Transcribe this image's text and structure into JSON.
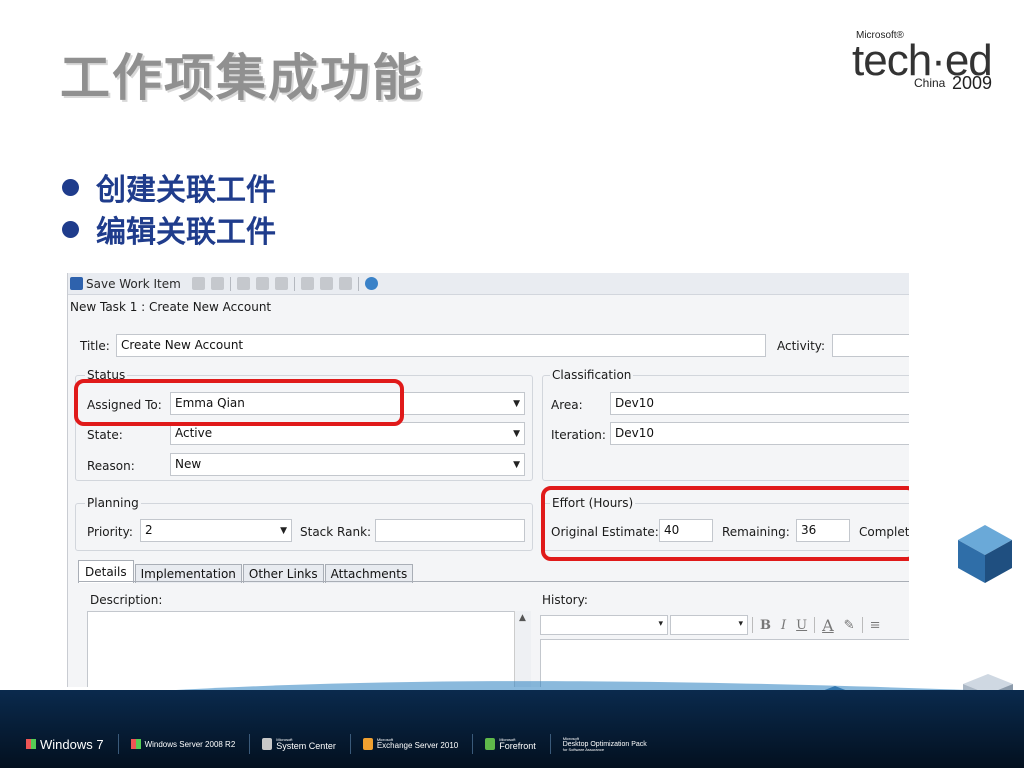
{
  "slide": {
    "title": "工作项集成功能",
    "bullets": [
      "创建关联工件",
      "编辑关联工件"
    ]
  },
  "logo": {
    "maker": "Microsoft®",
    "brand": "tech·ed",
    "region": "China",
    "year": "2009"
  },
  "toolbar": {
    "save_label": "Save Work Item",
    "icons": [
      "save-icon",
      "refresh-icon",
      "undo-icon",
      "copy-icon",
      "paste-icon",
      "attach-icon",
      "link-icon",
      "print-icon",
      "mail-icon",
      "help-icon"
    ]
  },
  "form": {
    "title": "New Task 1 : Create New Account",
    "title_label": "Title:",
    "title_value": "Create New Account",
    "activity_label": "Activity:",
    "activity_value": "",
    "status": {
      "header": "Status",
      "assigned_label": "Assigned To:",
      "assigned_value": "Emma Qian",
      "state_label": "State:",
      "state_value": "Active",
      "reason_label": "Reason:",
      "reason_value": "New"
    },
    "classification": {
      "header": "Classification",
      "area_label": "Area:",
      "area_value": "Dev10",
      "iteration_label": "Iteration:",
      "iteration_value": "Dev10"
    },
    "planning": {
      "header": "Planning",
      "priority_label": "Priority:",
      "priority_value": "2",
      "stack_rank_label": "Stack Rank:",
      "stack_rank_value": ""
    },
    "effort": {
      "header": "Effort (Hours)",
      "original_label": "Original Estimate:",
      "original_value": "40",
      "remaining_label": "Remaining:",
      "remaining_value": "36",
      "completed_label": "Complet"
    },
    "tabs": [
      "Details",
      "Implementation",
      "Other Links",
      "Attachments"
    ],
    "description_label": "Description:",
    "history_label": "History:",
    "rte_buttons": [
      "B",
      "I",
      "U",
      "A"
    ]
  },
  "footer": {
    "products": [
      {
        "name": "Windows 7",
        "pre": ""
      },
      {
        "name": "Windows Server 2008 R2",
        "pre": ""
      },
      {
        "name": "System Center",
        "pre": "Microsoft"
      },
      {
        "name": "Exchange Server 2010",
        "pre": "Microsoft"
      },
      {
        "name": "Forefront",
        "pre": "Microsoft"
      },
      {
        "name": "Desktop Optimization Pack",
        "pre": "Microsoft",
        "sub": "for Software Assurance"
      }
    ]
  },
  "colors": {
    "bullet_blue": "#1f3c8c",
    "highlight_red": "#e01a1a",
    "footer_navy": "#0a2a4d"
  }
}
